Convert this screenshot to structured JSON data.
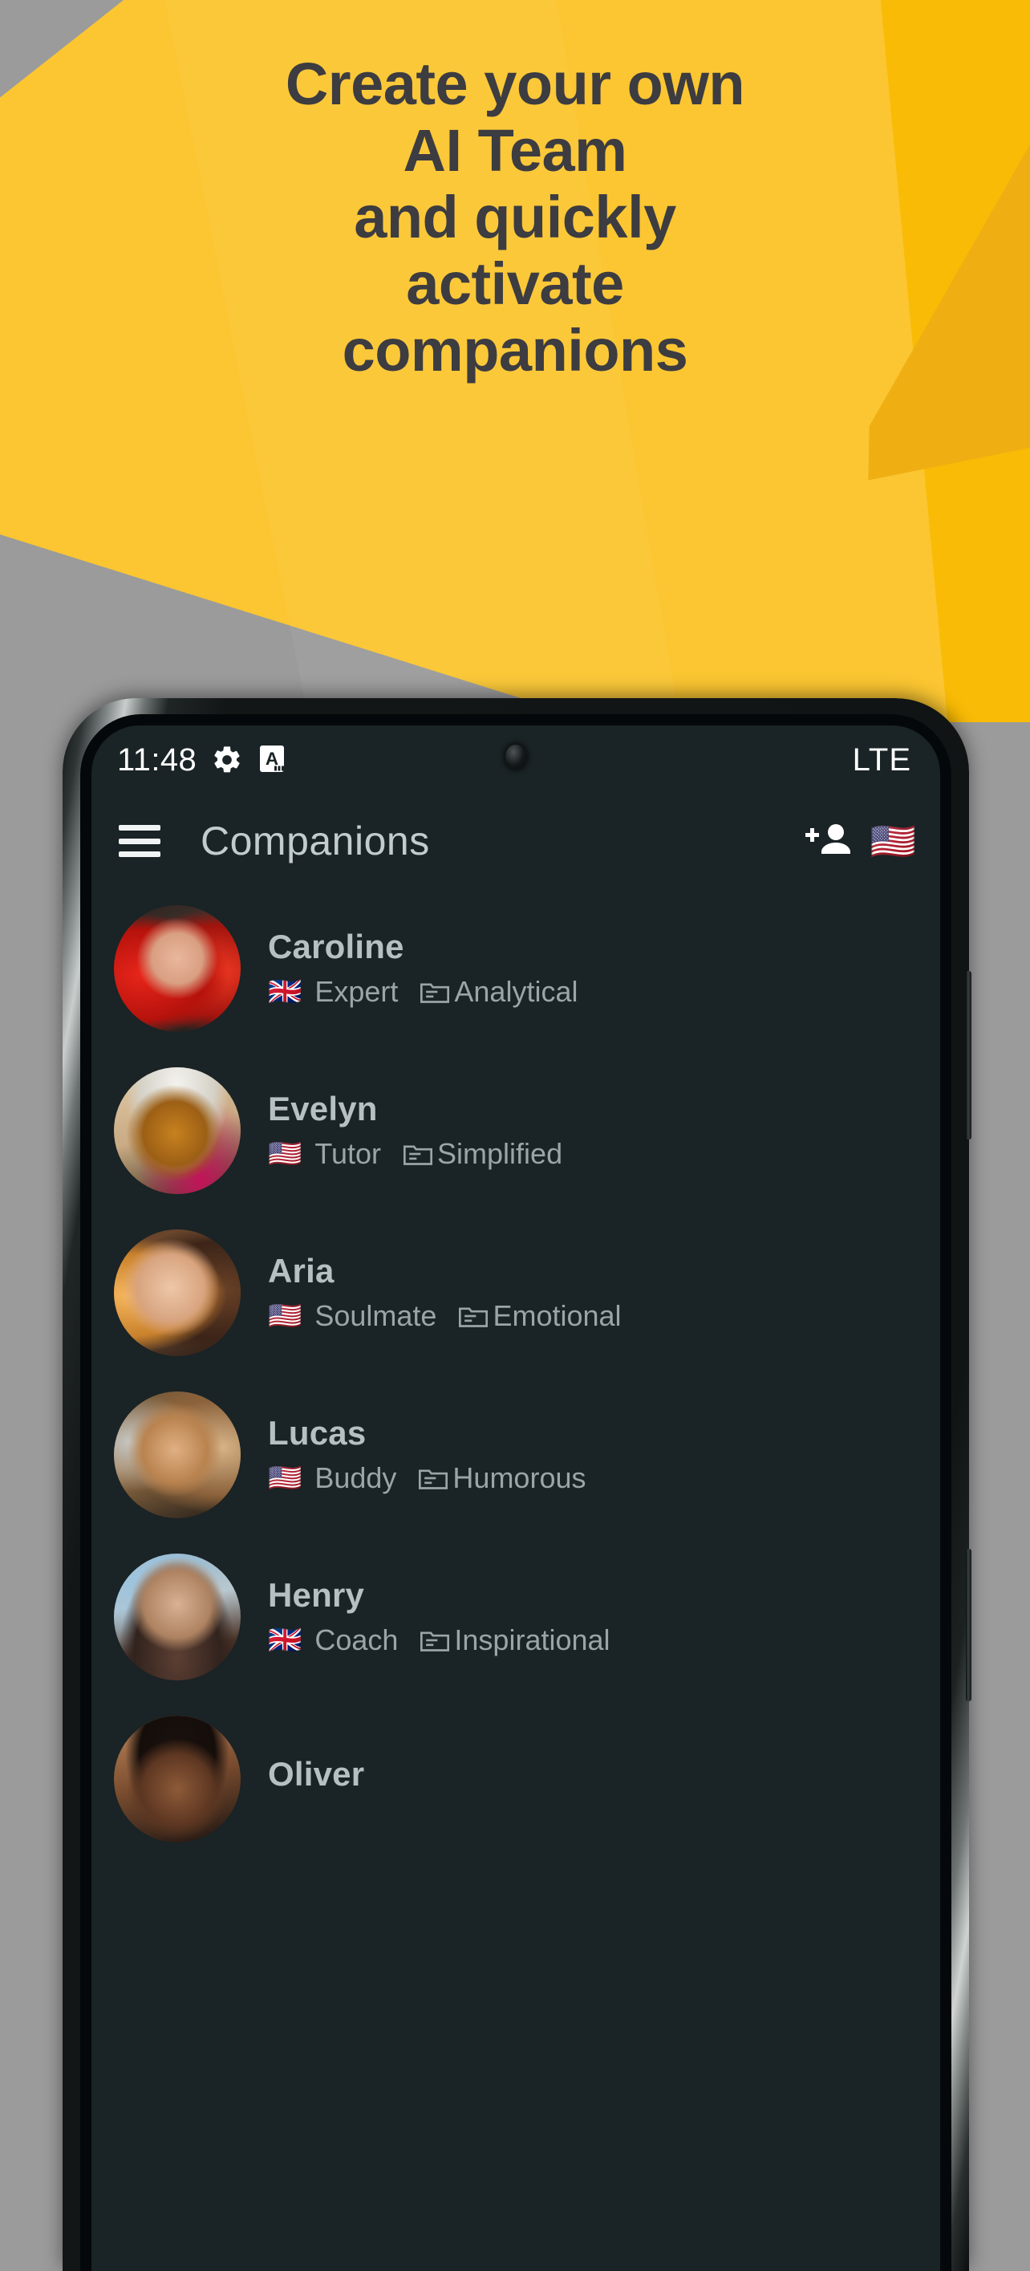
{
  "promo": {
    "headline": "Create your own\nAI Team\nand quickly\nactivate\ncompanions",
    "bg_yellow": "#FBC631",
    "bg_yellow_dark": "#F9BB05",
    "bg_gray": "#9b9b9b",
    "text_color": "#3c3c41"
  },
  "statusbar": {
    "time": "11:48",
    "gear_icon": "gear-icon",
    "badge_icon": "a-badge-icon",
    "network": "LTE"
  },
  "appbar": {
    "menu_icon": "hamburger-menu-icon",
    "title": "Companions",
    "add_icon": "add-person-icon",
    "language_flag": "🇺🇸"
  },
  "app": {
    "background": "#1a2325",
    "name_color": "#b6bfc2",
    "meta_color": "#9aa5a8"
  },
  "companions": [
    {
      "name": "Caroline",
      "flag": "🇬🇧",
      "role": "Expert",
      "topic": "Analytical",
      "topic_icon": "folder-topic-icon",
      "avatar": "avatar-caroline"
    },
    {
      "name": "Evelyn",
      "flag": "🇺🇸",
      "role": "Tutor",
      "topic": "Simplified",
      "topic_icon": "folder-topic-icon",
      "avatar": "avatar-evelyn"
    },
    {
      "name": "Aria",
      "flag": "🇺🇸",
      "role": "Soulmate",
      "topic": "Emotional",
      "topic_icon": "folder-topic-icon",
      "avatar": "avatar-aria"
    },
    {
      "name": "Lucas",
      "flag": "🇺🇸",
      "role": "Buddy",
      "topic": "Humorous",
      "topic_icon": "folder-topic-icon",
      "avatar": "avatar-lucas"
    },
    {
      "name": "Henry",
      "flag": "🇬🇧",
      "role": "Coach",
      "topic": "Inspirational",
      "topic_icon": "folder-topic-icon",
      "avatar": "avatar-henry"
    },
    {
      "name": "Oliver",
      "flag": "",
      "role": "",
      "topic": "",
      "topic_icon": "folder-topic-icon",
      "avatar": "avatar-oliver"
    }
  ]
}
